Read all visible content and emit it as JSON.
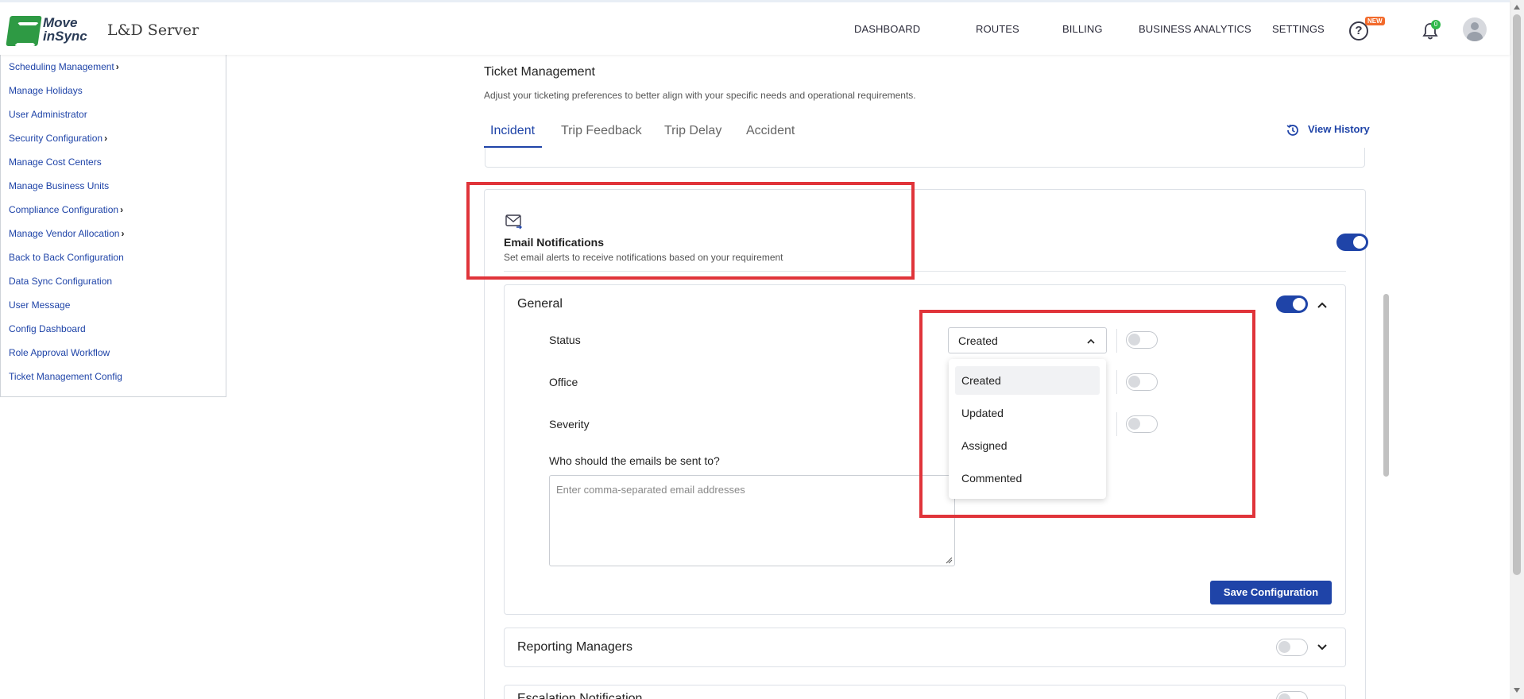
{
  "header": {
    "logo_line1": "Move",
    "logo_line2": "inSync",
    "app_name": "L&D Server",
    "nav": [
      "DASHBOARD",
      "ROUTES",
      "BILLING",
      "BUSINESS ANALYTICS",
      "SETTINGS"
    ],
    "new_badge": "NEW",
    "help_glyph": "?",
    "notification_count": "0"
  },
  "sidebar": {
    "items": [
      {
        "label": "Scheduling Management",
        "chevron": "›"
      },
      {
        "label": "Manage Holidays"
      },
      {
        "label": "User Administrator"
      },
      {
        "label": "Security Configuration",
        "chevron": "›"
      },
      {
        "label": "Manage Cost Centers"
      },
      {
        "label": "Manage Business Units"
      },
      {
        "label": "Compliance Configuration",
        "chevron": "›"
      },
      {
        "label": "Manage Vendor Allocation",
        "chevron": "›"
      },
      {
        "label": "Back to Back Configuration"
      },
      {
        "label": "Data Sync Configuration"
      },
      {
        "label": "User Message"
      },
      {
        "label": "Config Dashboard"
      },
      {
        "label": "Role Approval Workflow"
      },
      {
        "label": "Ticket Management Config"
      }
    ]
  },
  "main": {
    "title": "Ticket Management",
    "subtitle": "Adjust your ticketing preferences to better align with your specific needs and operational requirements.",
    "tabs": [
      "Incident",
      "Trip Feedback",
      "Trip Delay",
      "Accident"
    ],
    "active_tab": "Incident",
    "view_history": "View History",
    "email_notifications": {
      "title": "Email Notifications",
      "subtitle": "Set email alerts to receive notifications based on your requirement",
      "enabled": true
    },
    "general": {
      "title": "General",
      "enabled": true,
      "rows": [
        {
          "label": "Status",
          "enabled": false
        },
        {
          "label": "Office",
          "enabled": false
        },
        {
          "label": "Severity",
          "enabled": false
        }
      ],
      "status_select": {
        "value": "Created",
        "options": [
          "Created",
          "Updated",
          "Assigned",
          "Commented"
        ]
      },
      "recipients_label": "Who should the emails be sent to?",
      "recipients_placeholder": "Enter comma-separated email addresses",
      "save_label": "Save Configuration"
    },
    "reporting_managers": {
      "title": "Reporting Managers",
      "enabled": false
    },
    "escalation": {
      "title": "Escalation Notification",
      "enabled": false
    }
  },
  "colors": {
    "accent": "#1f44a8",
    "highlight": "#e0343a",
    "brand_green": "#2e9a44"
  }
}
